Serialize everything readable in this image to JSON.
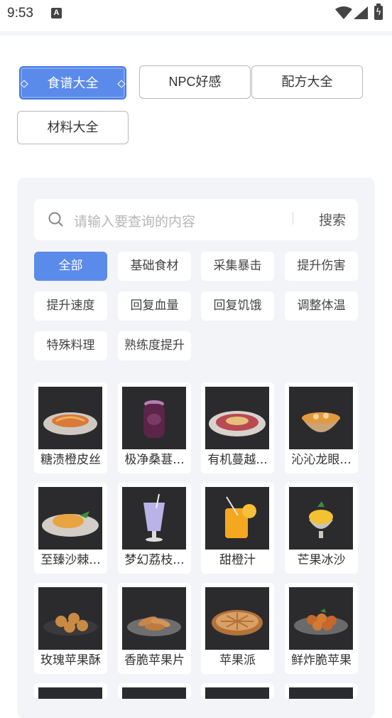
{
  "status": {
    "time": "9:53",
    "app_badge": "A"
  },
  "tabs": [
    {
      "label": "食谱大全",
      "active": true
    },
    {
      "label": "NPC好感",
      "active": false
    },
    {
      "label": "配方大全",
      "active": false
    },
    {
      "label": "材料大全",
      "active": false
    }
  ],
  "search": {
    "placeholder": "请输入要查询的内容",
    "button": "搜索"
  },
  "filters": [
    {
      "label": "全部",
      "active": true
    },
    {
      "label": "基础食材"
    },
    {
      "label": "采集暴击"
    },
    {
      "label": "提升伤害"
    },
    {
      "label": "提升速度"
    },
    {
      "label": "回复血量"
    },
    {
      "label": "回复饥饿"
    },
    {
      "label": "调整体温"
    },
    {
      "label": "特殊料理"
    },
    {
      "label": "熟练度提升"
    }
  ],
  "recipes": [
    {
      "name": "糖渍橙皮丝",
      "icon": "orange-peel-plate-icon"
    },
    {
      "name": "极净桑葚...",
      "icon": "mulberry-jar-icon"
    },
    {
      "name": "有机蔓越...",
      "icon": "cranberry-plate-icon"
    },
    {
      "name": "沁沁龙眼...",
      "icon": "longan-bowl-icon"
    },
    {
      "name": "至臻沙棘...",
      "icon": "seabuckthorn-plate-icon"
    },
    {
      "name": "梦幻荔枝...",
      "icon": "lychee-cup-icon"
    },
    {
      "name": "甜橙汁",
      "icon": "orange-juice-icon"
    },
    {
      "name": "芒果冰沙",
      "icon": "mango-smoothie-icon"
    },
    {
      "name": "玫瑰苹果酥",
      "icon": "rose-apple-pastry-icon"
    },
    {
      "name": "香脆苹果片",
      "icon": "apple-chips-icon"
    },
    {
      "name": "苹果派",
      "icon": "apple-pie-icon"
    },
    {
      "name": "鲜炸脆苹果",
      "icon": "fried-apple-icon"
    }
  ],
  "colors": {
    "accent": "#5b8bea",
    "panel": "#f2f4f8"
  }
}
